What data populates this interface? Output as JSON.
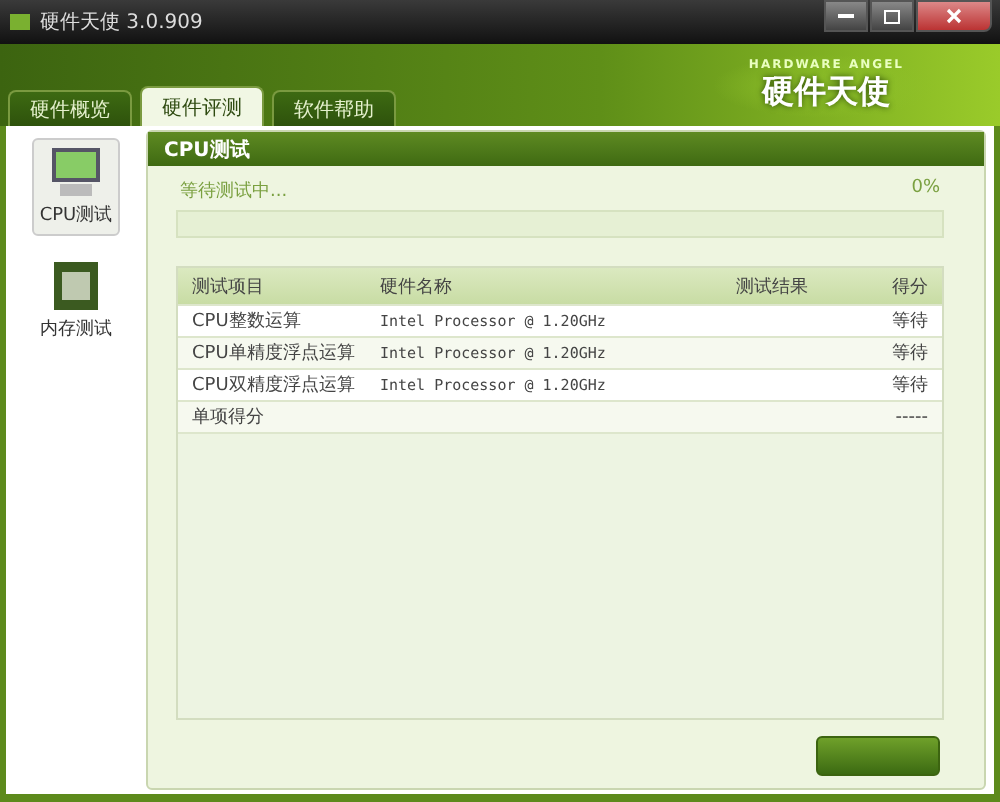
{
  "window": {
    "title": "硬件天使 3.0.909"
  },
  "logo": {
    "subtitle": "HARDWARE ANGEL",
    "title": "硬件天使"
  },
  "tabs": [
    {
      "label": "硬件概览",
      "selected": false
    },
    {
      "label": "硬件评测",
      "selected": true
    },
    {
      "label": "软件帮助",
      "selected": false
    }
  ],
  "sidebar": {
    "items": [
      {
        "label": "CPU测试",
        "selected": true,
        "kind": "cpu"
      },
      {
        "label": "内存测试",
        "selected": false,
        "kind": "memory"
      }
    ]
  },
  "panel": {
    "title": "CPU测试",
    "status": "等待测试中...",
    "percent": "0%"
  },
  "table": {
    "columns": [
      "测试项目",
      "硬件名称",
      "测试结果",
      "得分"
    ],
    "rows": [
      [
        "CPU整数运算",
        "Intel Processor @ 1.20GHz",
        "",
        "等待"
      ],
      [
        "CPU单精度浮点运算",
        "Intel Processor @ 1.20GHz",
        "",
        "等待"
      ],
      [
        "CPU双精度浮点运算",
        "Intel Processor @ 1.20GHz",
        "",
        "等待"
      ]
    ],
    "summary": {
      "label": "单项得分",
      "score": "-----"
    }
  }
}
